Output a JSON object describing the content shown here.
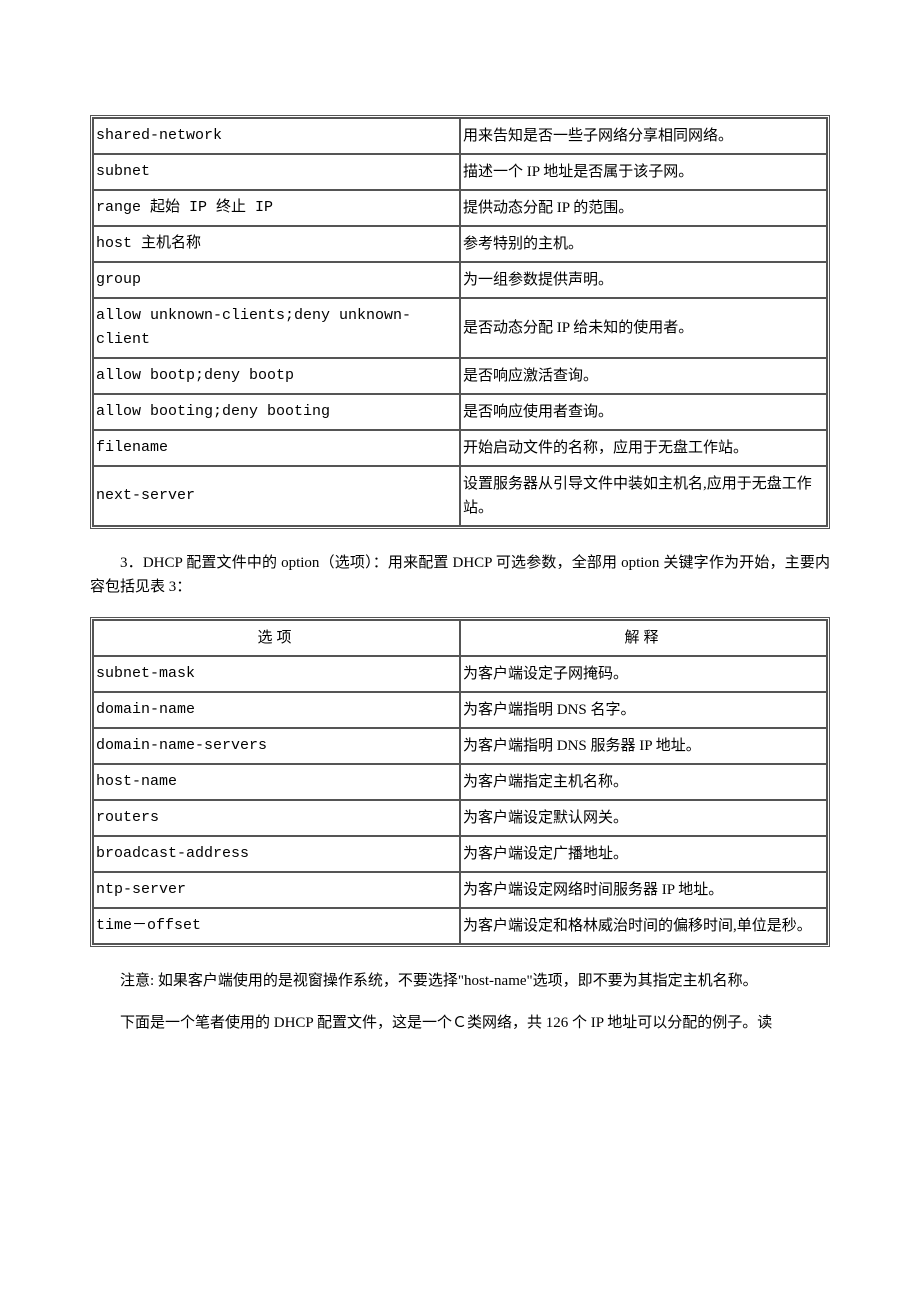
{
  "table1": {
    "rows": [
      {
        "k": "shared-network",
        "d": "用来告知是否一些子网络分享相同网络。"
      },
      {
        "k": "subnet",
        "d": "描述一个 IP 地址是否属于该子网。"
      },
      {
        "k": "range 起始 IP 终止 IP",
        "d": "提供动态分配 IP 的范围。"
      },
      {
        "k": "host 主机名称",
        "d": "参考特别的主机。"
      },
      {
        "k": "group",
        "d": "为一组参数提供声明。"
      },
      {
        "k": "allow unknown-clients;deny unknown-client",
        "d": "是否动态分配 IP 给未知的使用者。"
      },
      {
        "k": "allow bootp;deny bootp",
        "d": "是否响应激活查询。"
      },
      {
        "k": "allow booting;deny booting",
        "d": "是否响应使用者查询。"
      },
      {
        "k": "filename",
        "d": "开始启动文件的名称，应用于无盘工作站。"
      },
      {
        "k": "next-server",
        "d": "设置服务器从引导文件中装如主机名,应用于无盘工作站。"
      }
    ]
  },
  "para1": "3．DHCP 配置文件中的 option（选项）：用来配置 DHCP 可选参数，全部用 option 关键字作为开始，主要内容包括见表 3：",
  "table2": {
    "header": {
      "k": "选项",
      "d": "解释"
    },
    "rows": [
      {
        "k": "subnet-mask",
        "d": "为客户端设定子网掩码。"
      },
      {
        "k": "domain-name",
        "d": "为客户端指明 DNS 名字。"
      },
      {
        "k": "domain-name-servers",
        "d": "为客户端指明 DNS 服务器 IP 地址。"
      },
      {
        "k": "host-name",
        "d": "为客户端指定主机名称。"
      },
      {
        "k": "routers",
        "d": "为客户端设定默认网关。"
      },
      {
        "k": "broadcast-address",
        "d": "为客户端设定广播地址。"
      },
      {
        "k": "ntp-server",
        "d": "为客户端设定网络时间服务器 IP 地址。"
      },
      {
        "k": "time－offset",
        "d": "为客户端设定和格林威治时间的偏移时间,单位是秒。"
      }
    ]
  },
  "para2": "注意: 如果客户端使用的是视窗操作系统，不要选择\"host-name\"选项，即不要为其指定主机名称。",
  "para3": "下面是一个笔者使用的 DHCP 配置文件，这是一个Ｃ类网络，共 126 个 IP 地址可以分配的例子。读"
}
